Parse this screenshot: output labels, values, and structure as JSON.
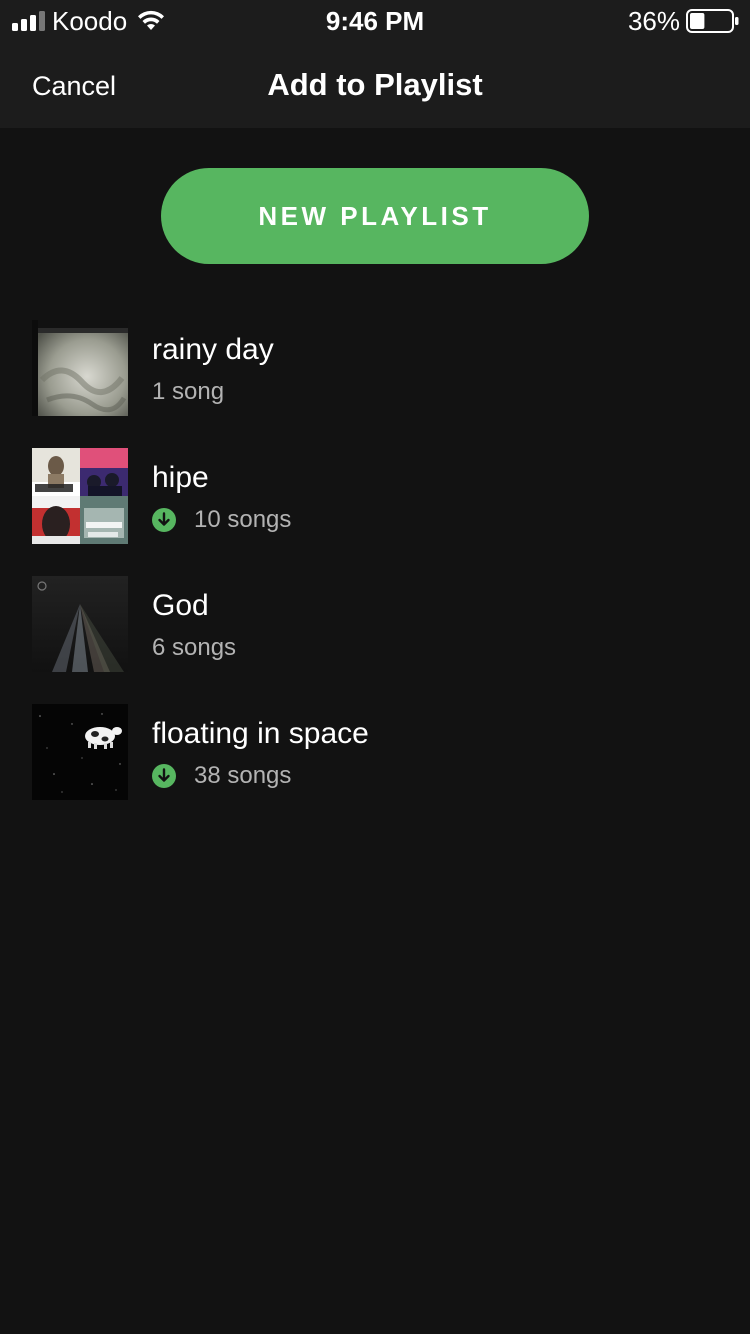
{
  "status_bar": {
    "carrier": "Koodo",
    "time": "9:46 PM",
    "battery": "36%",
    "battery_level": 0.36
  },
  "nav": {
    "cancel_label": "Cancel",
    "title": "Add to Playlist"
  },
  "new_playlist_label": "NEW PLAYLIST",
  "playlists": [
    {
      "name": "rainy day",
      "count": "1 song",
      "downloaded": false
    },
    {
      "name": "hipe",
      "count": "10 songs",
      "downloaded": true
    },
    {
      "name": "God",
      "count": "6 songs",
      "downloaded": false
    },
    {
      "name": "floating in space",
      "count": "38 songs",
      "downloaded": true
    }
  ],
  "colors": {
    "background": "#121212",
    "header": "#1c1c1c",
    "accent": "#57b660",
    "secondary_text": "#b3b3b3"
  }
}
